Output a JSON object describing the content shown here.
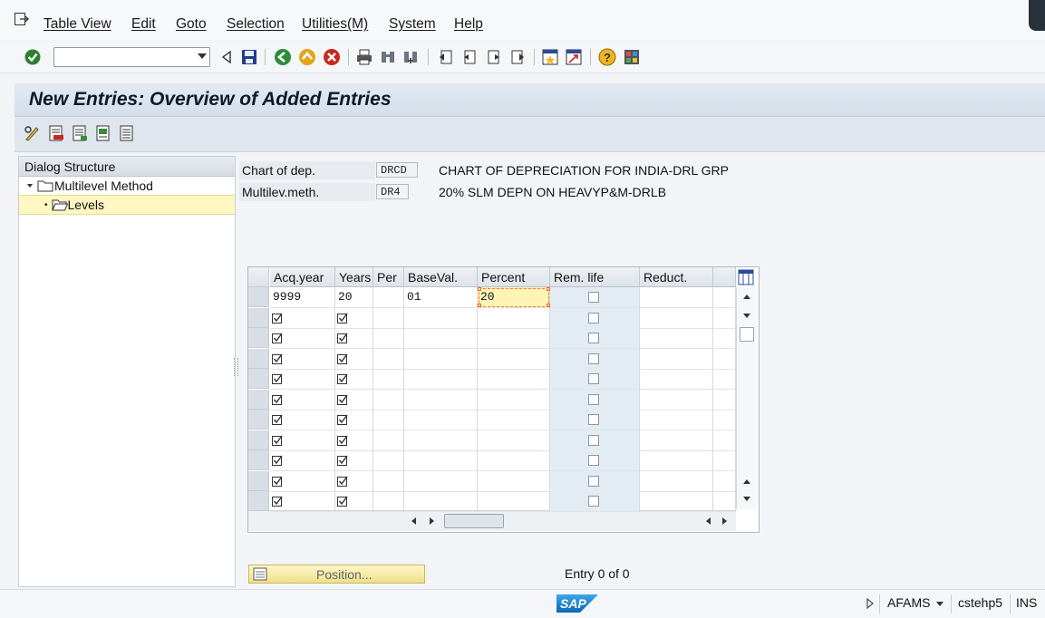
{
  "menu": {
    "items": [
      "Table View",
      "Edit",
      "Goto",
      "Selection",
      "Utilities(M)",
      "System",
      "Help"
    ]
  },
  "toolbar": {
    "command_field": {
      "value": "",
      "placeholder": ""
    }
  },
  "title": "New Entries: Overview of Added Entries",
  "dialog_structure": {
    "header": "Dialog Structure",
    "items": [
      {
        "label": "Multilevel Method",
        "level": 0,
        "expanded": true
      },
      {
        "label": "Levels",
        "level": 1,
        "selected": true
      }
    ]
  },
  "header_fields": {
    "chart_of_dep": {
      "label": "Chart of dep.",
      "value": "DRCD",
      "description": "CHART OF DEPRECIATION FOR INDIA-DRL GRP"
    },
    "multilev_meth": {
      "label": "Multilev.meth.",
      "value": "DR4",
      "description": "20% SLM DEPN ON HEAVYP&M-DRLB"
    }
  },
  "table": {
    "columns": [
      "Acq.year",
      "Years",
      "Per",
      "BaseVal.",
      "Percent",
      "Rem. life",
      "Reduct."
    ],
    "first_row": {
      "acq_year": "9999",
      "years": "20",
      "per": "",
      "base_val": "01",
      "percent": "20",
      "rem_life": false,
      "reduct": ""
    },
    "empty_rows": 10
  },
  "position_button": {
    "label": "Position..."
  },
  "entry_counter": "Entry 0 of 0",
  "status": {
    "logo": "SAP",
    "system": "AFAMS",
    "server": "cstehp5",
    "mode": "INS"
  },
  "colors": {
    "title_band": "#d4dee9",
    "selection_yellow": "#fff7c2",
    "focus_outline": "#ff7a2a"
  }
}
